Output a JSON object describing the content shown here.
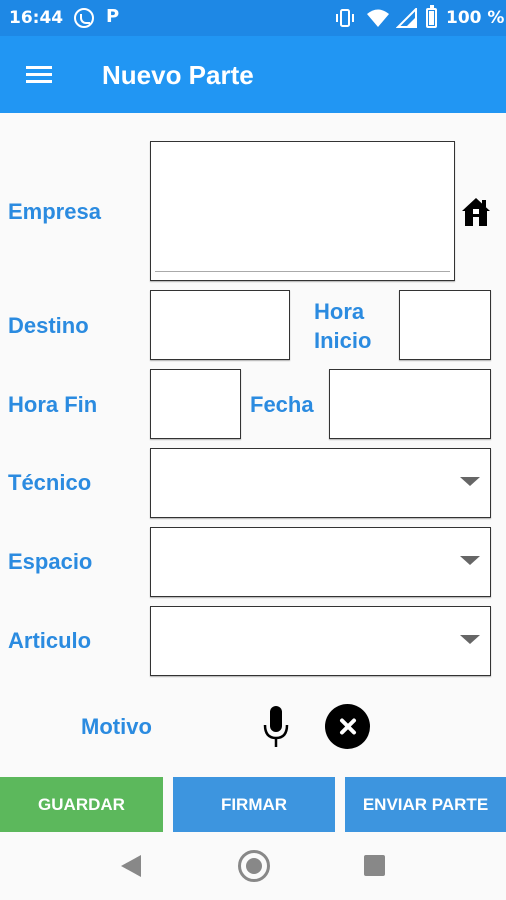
{
  "status_bar": {
    "time": "16:44",
    "parking_icon_letter": "P",
    "battery_percent": "100 %"
  },
  "app_bar": {
    "title": "Nuevo Parte",
    "menu_icon": "hamburger-menu-icon"
  },
  "form": {
    "empresa": {
      "label": "Empresa",
      "value": ""
    },
    "destino": {
      "label": "Destino",
      "value": ""
    },
    "hora_inicio": {
      "label_line1": "Hora",
      "label_line2": "Inicio",
      "value": ""
    },
    "hora_fin": {
      "label": "Hora Fin",
      "value": ""
    },
    "fecha": {
      "label": "Fecha",
      "value": ""
    },
    "tecnico": {
      "label": "Técnico",
      "selected": ""
    },
    "espacio": {
      "label": "Espacio",
      "selected": ""
    },
    "articulo": {
      "label": "Articulo",
      "selected": ""
    },
    "motivo": {
      "label": "Motivo"
    }
  },
  "icons": {
    "empresa_action": "home-icon",
    "motivo_voice": "microphone-icon",
    "motivo_clear": "close-icon"
  },
  "buttons": {
    "guardar": "GUARDAR",
    "firmar": "FIRMAR",
    "enviar": "ENVIAR PARTE"
  },
  "colors": {
    "app_bar": "#2196f3",
    "status_bar": "#1e88e5",
    "label": "#2b8be0",
    "guardar": "#5cb85c",
    "firmar": "#3d95df",
    "enviar": "#3d95df"
  }
}
